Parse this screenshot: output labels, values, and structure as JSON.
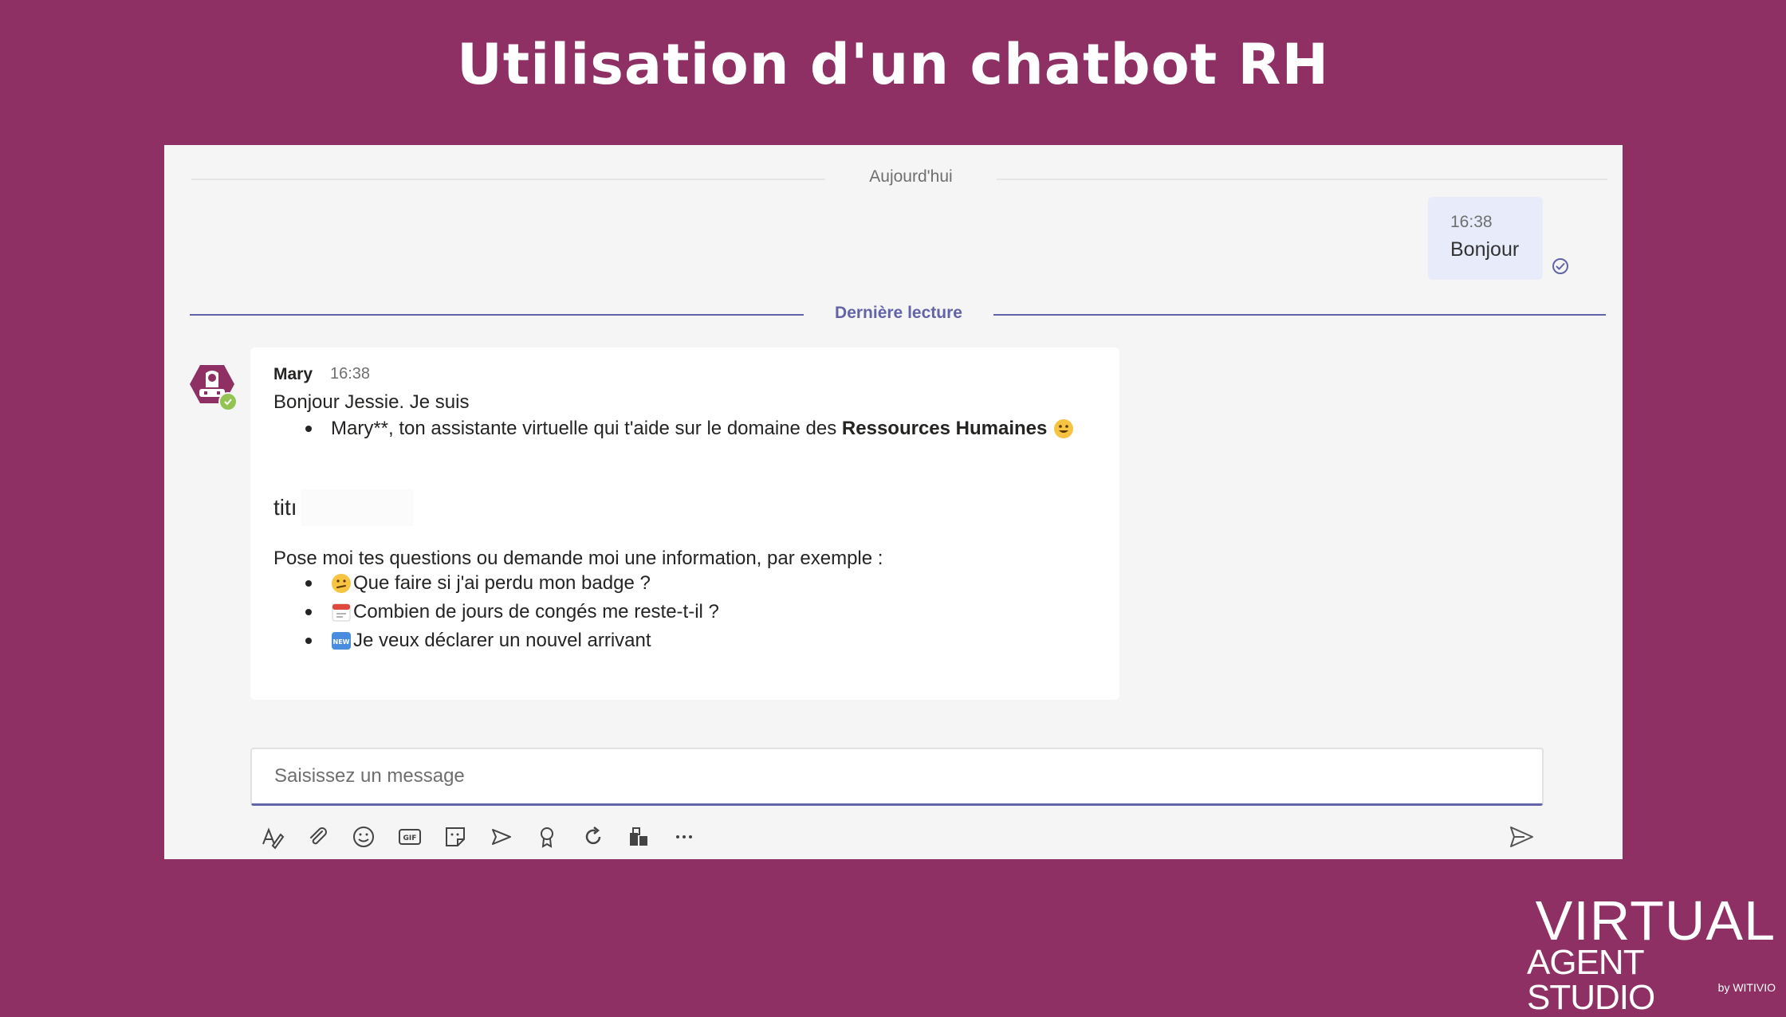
{
  "slide": {
    "title": "Utilisation d'un chatbot RH",
    "brand_line1": "VIRTUAL",
    "brand_line2": "AGENT STUDIO",
    "brand_line3": "by WITIVIO"
  },
  "colors": {
    "background": "#8e3063",
    "accent": "#6264a7",
    "own_bubble": "#e8ebfa",
    "presence": "#92c353"
  },
  "chat": {
    "date_divider": "Aujourd'hui",
    "own_message": {
      "time": "16:38",
      "text": "Bonjour",
      "status_icon": "read-check-icon"
    },
    "last_read_label": "Dernière lecture",
    "bot_message": {
      "sender": "Mary",
      "time": "16:38",
      "greeting": "Bonjour Jessie. Je suis",
      "intro_bullet_prefix": "Mary**, ton assistante virtuelle qui t'aide sur le domaine des ",
      "intro_bullet_bold": "Ressources Humaines",
      "intro_bullet_emoji": "smiley-emoji",
      "partial_title": "titı",
      "prompt": "Pose moi tes questions ou demande moi une information, par exemple :",
      "examples": [
        {
          "emoji": "confused-face-emoji",
          "text": "Que faire si j'ai perdu mon badge ?"
        },
        {
          "emoji": "calendar-emoji",
          "text": "Combien de jours de congés me reste-t-il ?"
        },
        {
          "emoji": "new-button-emoji",
          "text": "Je veux déclarer un nouvel arrivant"
        }
      ]
    }
  },
  "composer": {
    "placeholder": "Saisissez un message",
    "toolbar_icons": [
      "format-icon",
      "attach-icon",
      "emoji-icon",
      "gif-icon",
      "sticker-icon",
      "schedule-meeting-icon",
      "praise-icon",
      "loop-icon",
      "apps-icon",
      "more-options-icon"
    ],
    "send_icon": "send-icon"
  }
}
